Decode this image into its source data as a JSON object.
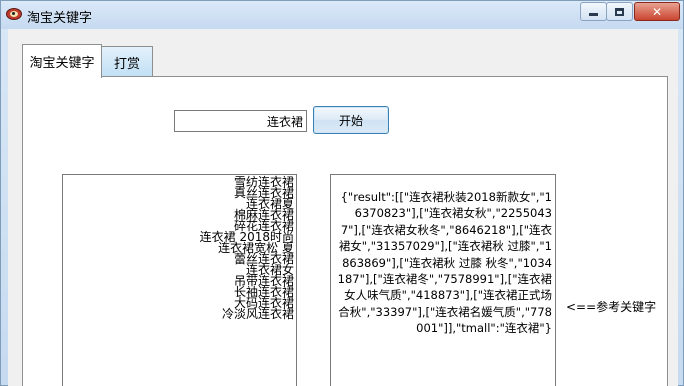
{
  "window": {
    "title": "淘宝关键字"
  },
  "tabs": [
    {
      "label": "淘宝关键字",
      "active": true
    },
    {
      "label": "打赏",
      "active": false
    }
  ],
  "search": {
    "value": "连衣裙",
    "start_label": "开始"
  },
  "keywords": [
    "雪纺连衣裙",
    "真丝连衣裙",
    "连衣裙夏",
    "棉麻连衣裙",
    "碎花连衣裙",
    "连衣裙 2018时尚",
    "连衣裙宽松 夏",
    "蕾丝连衣裙",
    "连衣裙女",
    "吊带连衣裙",
    "长袖连衣裙",
    "大码连衣裙",
    "冷淡风连衣裙"
  ],
  "result": {
    "text": "{\"result\":[[\"连衣裙秋装2018新款女\",\"16370823\"],[\"连衣裙女秋\",\"22550437\"],[\"连衣裙女秋冬\",\"8646218\"],[\"连衣裙女\",\"31357029\"],[\"连衣裙秋 过膝\",\"1863869\"],[\"连衣裙秋 过膝 秋冬\",\"1034187\"],[\"连衣裙冬\",\"7578991\"],[\"连衣裙女人味气质\",\"418873\"],[\"连衣裙正式场合秋\",\"33397\"],[\"连衣裙名媛气质\",\"778001\"]],\"tmall\":\"连衣裙\"}"
  },
  "ref_label": "<==参考关键字"
}
